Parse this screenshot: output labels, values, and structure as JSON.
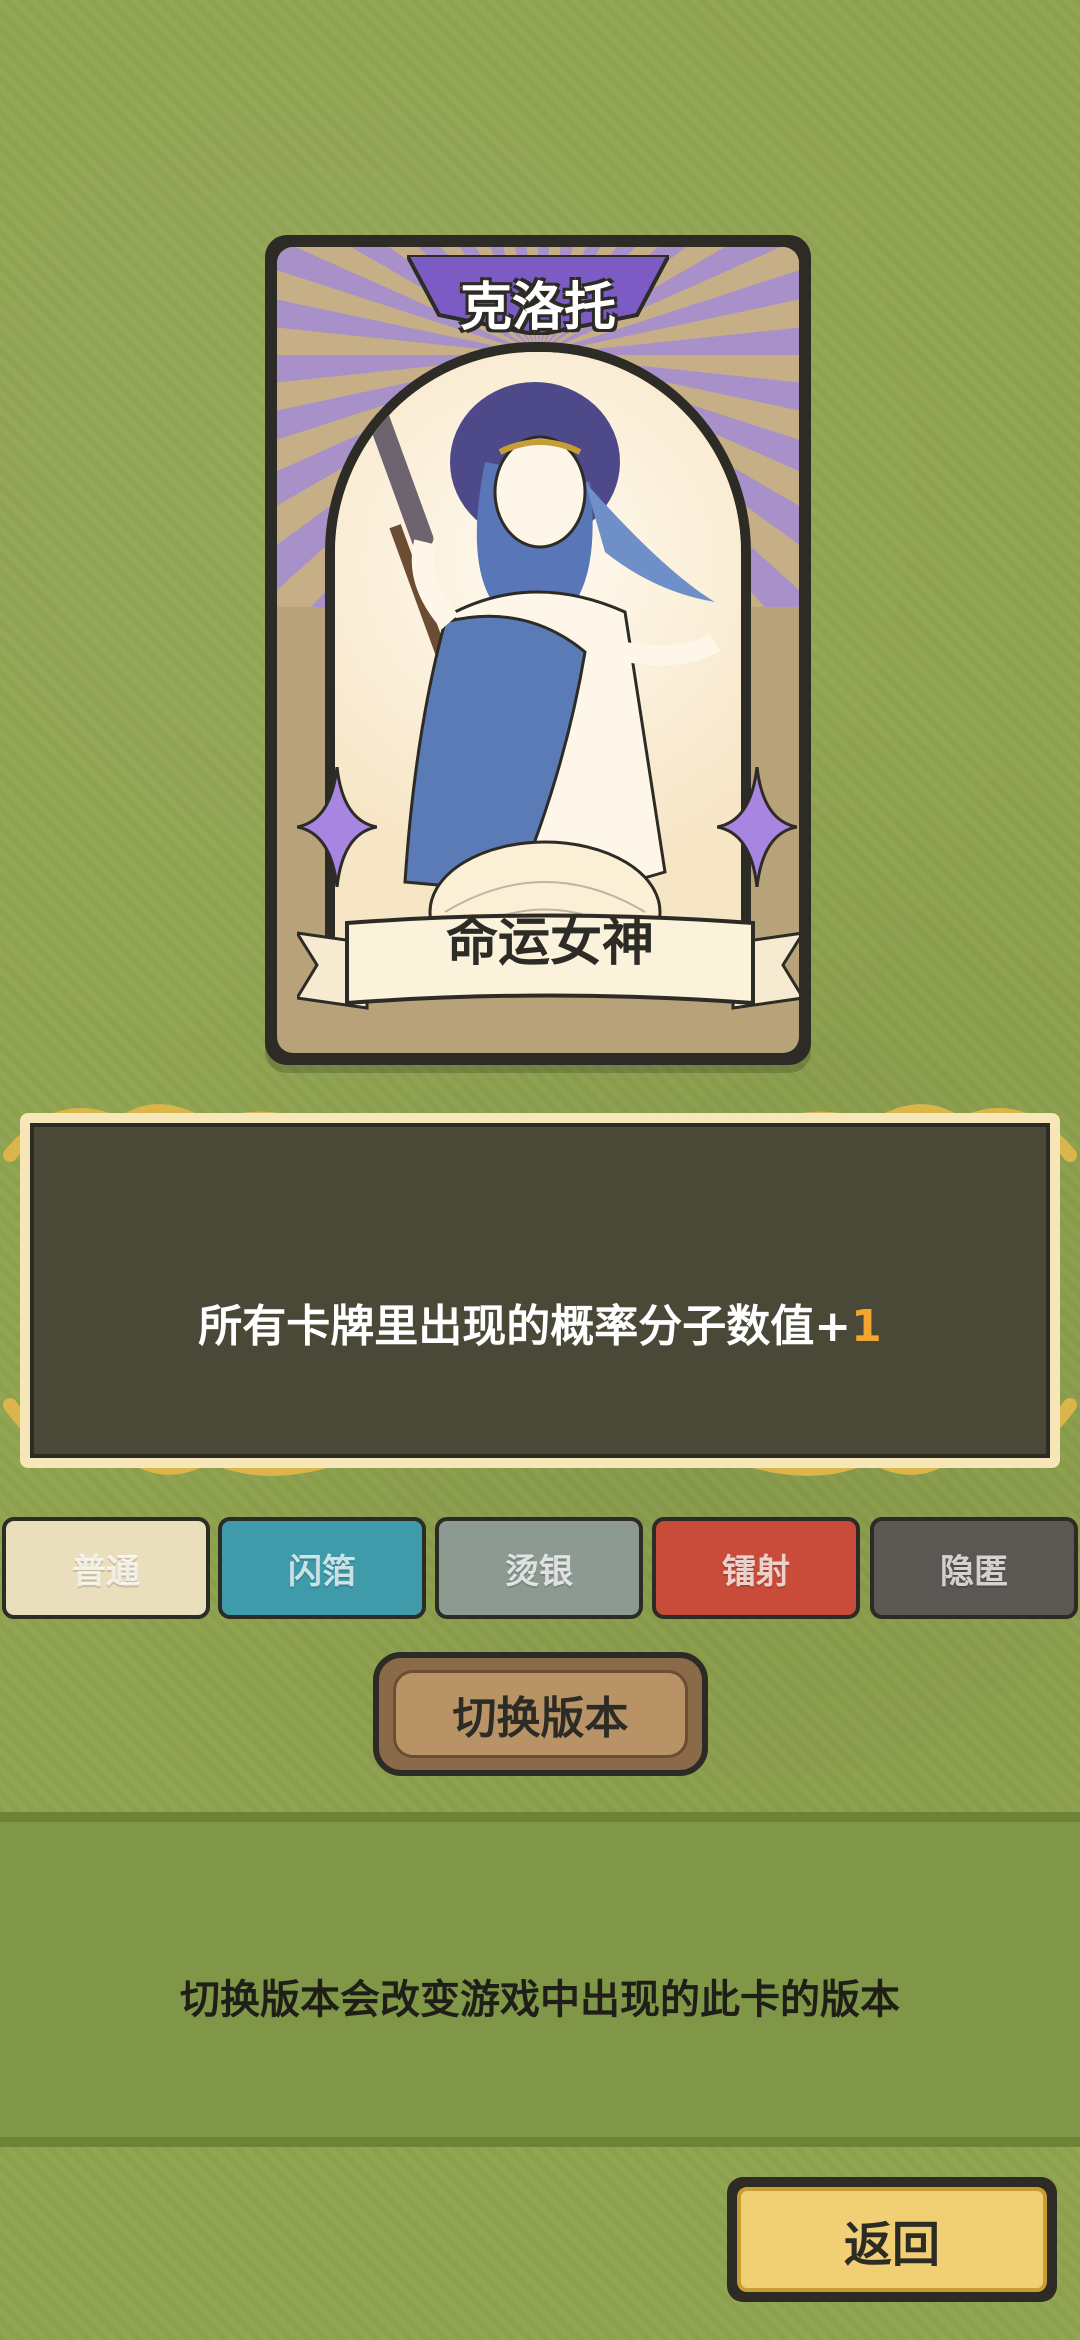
{
  "card": {
    "name": "克洛托",
    "title": "命运女神"
  },
  "description": {
    "text_prefix": "所有卡牌里出现的概率分子数值+",
    "value": "1"
  },
  "tabs": [
    {
      "label": "普通",
      "color": "#e9dfbd"
    },
    {
      "label": "闪箔",
      "color": "#3f9aaa"
    },
    {
      "label": "烫银",
      "color": "#8c9a92"
    },
    {
      "label": "镭射",
      "color": "#c84c39"
    },
    {
      "label": "隐匿",
      "color": "#5b5753"
    }
  ],
  "switch_button": {
    "label": "切换版本"
  },
  "info": {
    "text": "切换版本会改变游戏中出现的此卡的版本"
  },
  "back_button": {
    "label": "返回"
  }
}
